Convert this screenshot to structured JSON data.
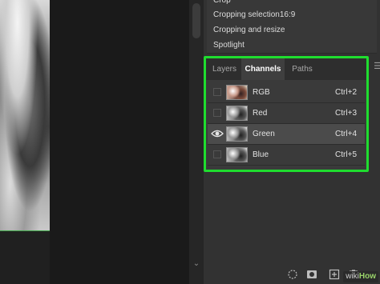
{
  "history": {
    "items": [
      {
        "label": "Crop"
      },
      {
        "label": "Cropping selection16:9"
      },
      {
        "label": "Cropping and resize"
      },
      {
        "label": "Spotlight"
      }
    ]
  },
  "channels_panel": {
    "tabs": [
      {
        "label": "Layers",
        "active": false
      },
      {
        "label": "Channels",
        "active": true
      },
      {
        "label": "Paths",
        "active": false
      }
    ],
    "menu_icon": "panel-menu-icon",
    "highlight_color": "#1fdd2f",
    "channels": [
      {
        "name": "RGB",
        "shortcut": "Ctrl+2",
        "visible": false,
        "selected": false
      },
      {
        "name": "Red",
        "shortcut": "Ctrl+3",
        "visible": false,
        "selected": false
      },
      {
        "name": "Green",
        "shortcut": "Ctrl+4",
        "visible": true,
        "selected": true
      },
      {
        "name": "Blue",
        "shortcut": "Ctrl+5",
        "visible": false,
        "selected": false
      }
    ]
  },
  "bottom_toolbar": {
    "icons": [
      "load-selection-icon",
      "save-selection-icon",
      "new-channel-icon",
      "delete-channel-icon"
    ]
  },
  "watermark": {
    "wiki": "wiki",
    "how": "How"
  }
}
